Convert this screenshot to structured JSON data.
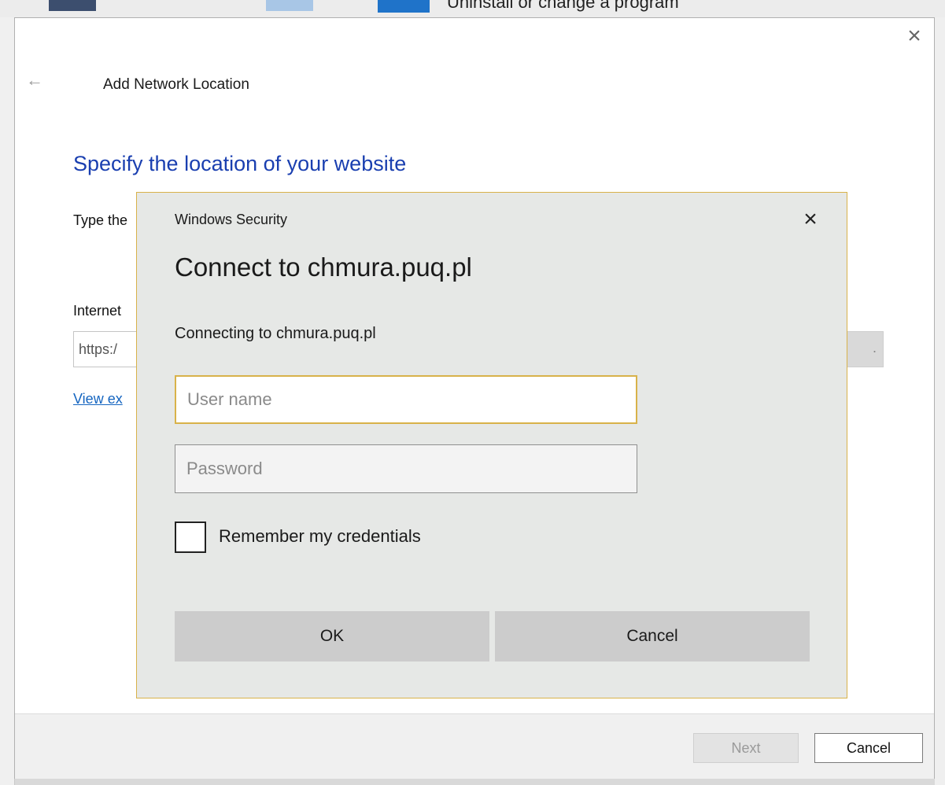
{
  "background": {
    "partial_text": "Uninstall or change a program"
  },
  "wizard": {
    "title": "Add Network Location",
    "heading": "Specify the location of your website",
    "instruction_partial": "Type the",
    "address_label_partial": "Internet",
    "address_value_partial": "https:/",
    "browse_partial": ".",
    "view_examples_partial": "View ex",
    "buttons": {
      "next": "Next",
      "cancel": "Cancel"
    }
  },
  "security_dialog": {
    "title": "Windows Security",
    "heading": "Connect to chmura.puq.pl",
    "subtext": "Connecting to chmura.puq.pl",
    "username_placeholder": "User name",
    "password_placeholder": "Password",
    "remember_label": "Remember my credentials",
    "remember_checked": false,
    "buttons": {
      "ok": "OK",
      "cancel": "Cancel"
    }
  },
  "colors": {
    "heading_blue": "#1a3fb0",
    "link_blue": "#1565c0",
    "dialog_border": "#d8b24a",
    "dialog_background": "#e6e8e6"
  }
}
